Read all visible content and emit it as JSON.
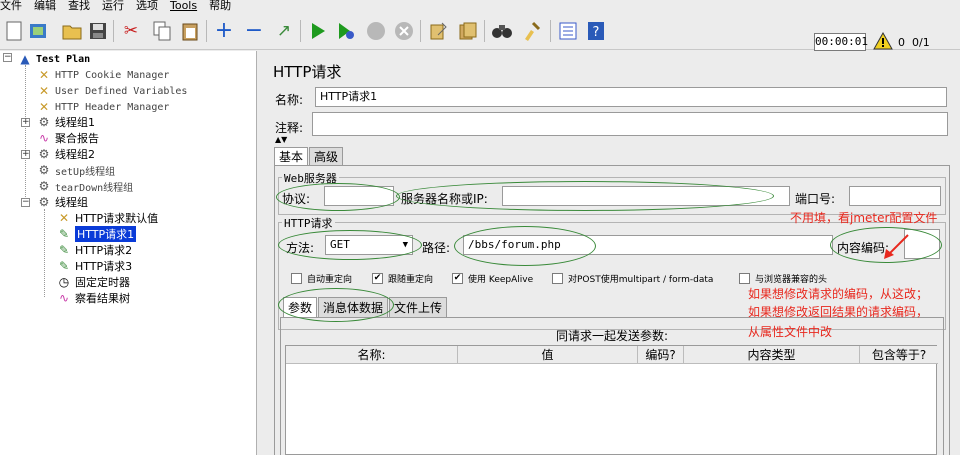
{
  "menu": [
    "文件",
    "编辑",
    "查找",
    "运行",
    "选项",
    "Tools",
    "帮助"
  ],
  "toolbar": {
    "timer": "00:00:01",
    "warning_count": "0",
    "thread_count": "0/1"
  },
  "tree": {
    "root": "Test Plan",
    "items": [
      "HTTP Cookie Manager",
      "User Defined Variables",
      "HTTP Header Manager",
      "线程组1",
      "聚合报告",
      "线程组2",
      "setUp线程组",
      "tearDown线程组",
      "线程组",
      "HTTP请求默认值",
      "HTTP请求1",
      "HTTP请求2",
      "HTTP请求3",
      "固定定时器",
      "察看结果树"
    ]
  },
  "panel": {
    "title": "HTTP请求",
    "name_label": "名称:",
    "name_value": "HTTP请求1",
    "comment_label": "注释:",
    "tabs": [
      "基本",
      "高级"
    ],
    "web_server_legend": "Web服务器",
    "protocol_label": "协议:",
    "server_label": "服务器名称或IP:",
    "port_label": "端口号:",
    "http_request_legend": "HTTP请求",
    "method_label": "方法:",
    "method_value": "GET",
    "path_label": "路径:",
    "path_value": "/bbs/forum.php",
    "encoding_label": "内容编码:",
    "checkboxes": [
      {
        "label": "自动重定向",
        "checked": false
      },
      {
        "label": "跟随重定向",
        "checked": true
      },
      {
        "label": "使用 KeepAlive",
        "checked": true
      },
      {
        "label": "对POST使用multipart / form-data",
        "checked": false
      },
      {
        "label": "与浏览器兼容的头",
        "checked": false
      }
    ],
    "subtabs": [
      "参数",
      "消息体数据",
      "文件上传"
    ],
    "params_title": "同请求一起发送参数:",
    "columns": [
      "名称:",
      "值",
      "编码?",
      "内容类型",
      "包含等于?"
    ]
  },
  "annotations": {
    "note1": "不用填，看jmeter配置文件",
    "note2": "如果想修改请求的编码，从这改；",
    "note3": "如果想修改返回结果的请求编码，",
    "note4": "从属性文件中改",
    "color": "#e8281e"
  },
  "colors": {
    "selection": "#0a3bd8",
    "oval": "#3a8a3a"
  }
}
